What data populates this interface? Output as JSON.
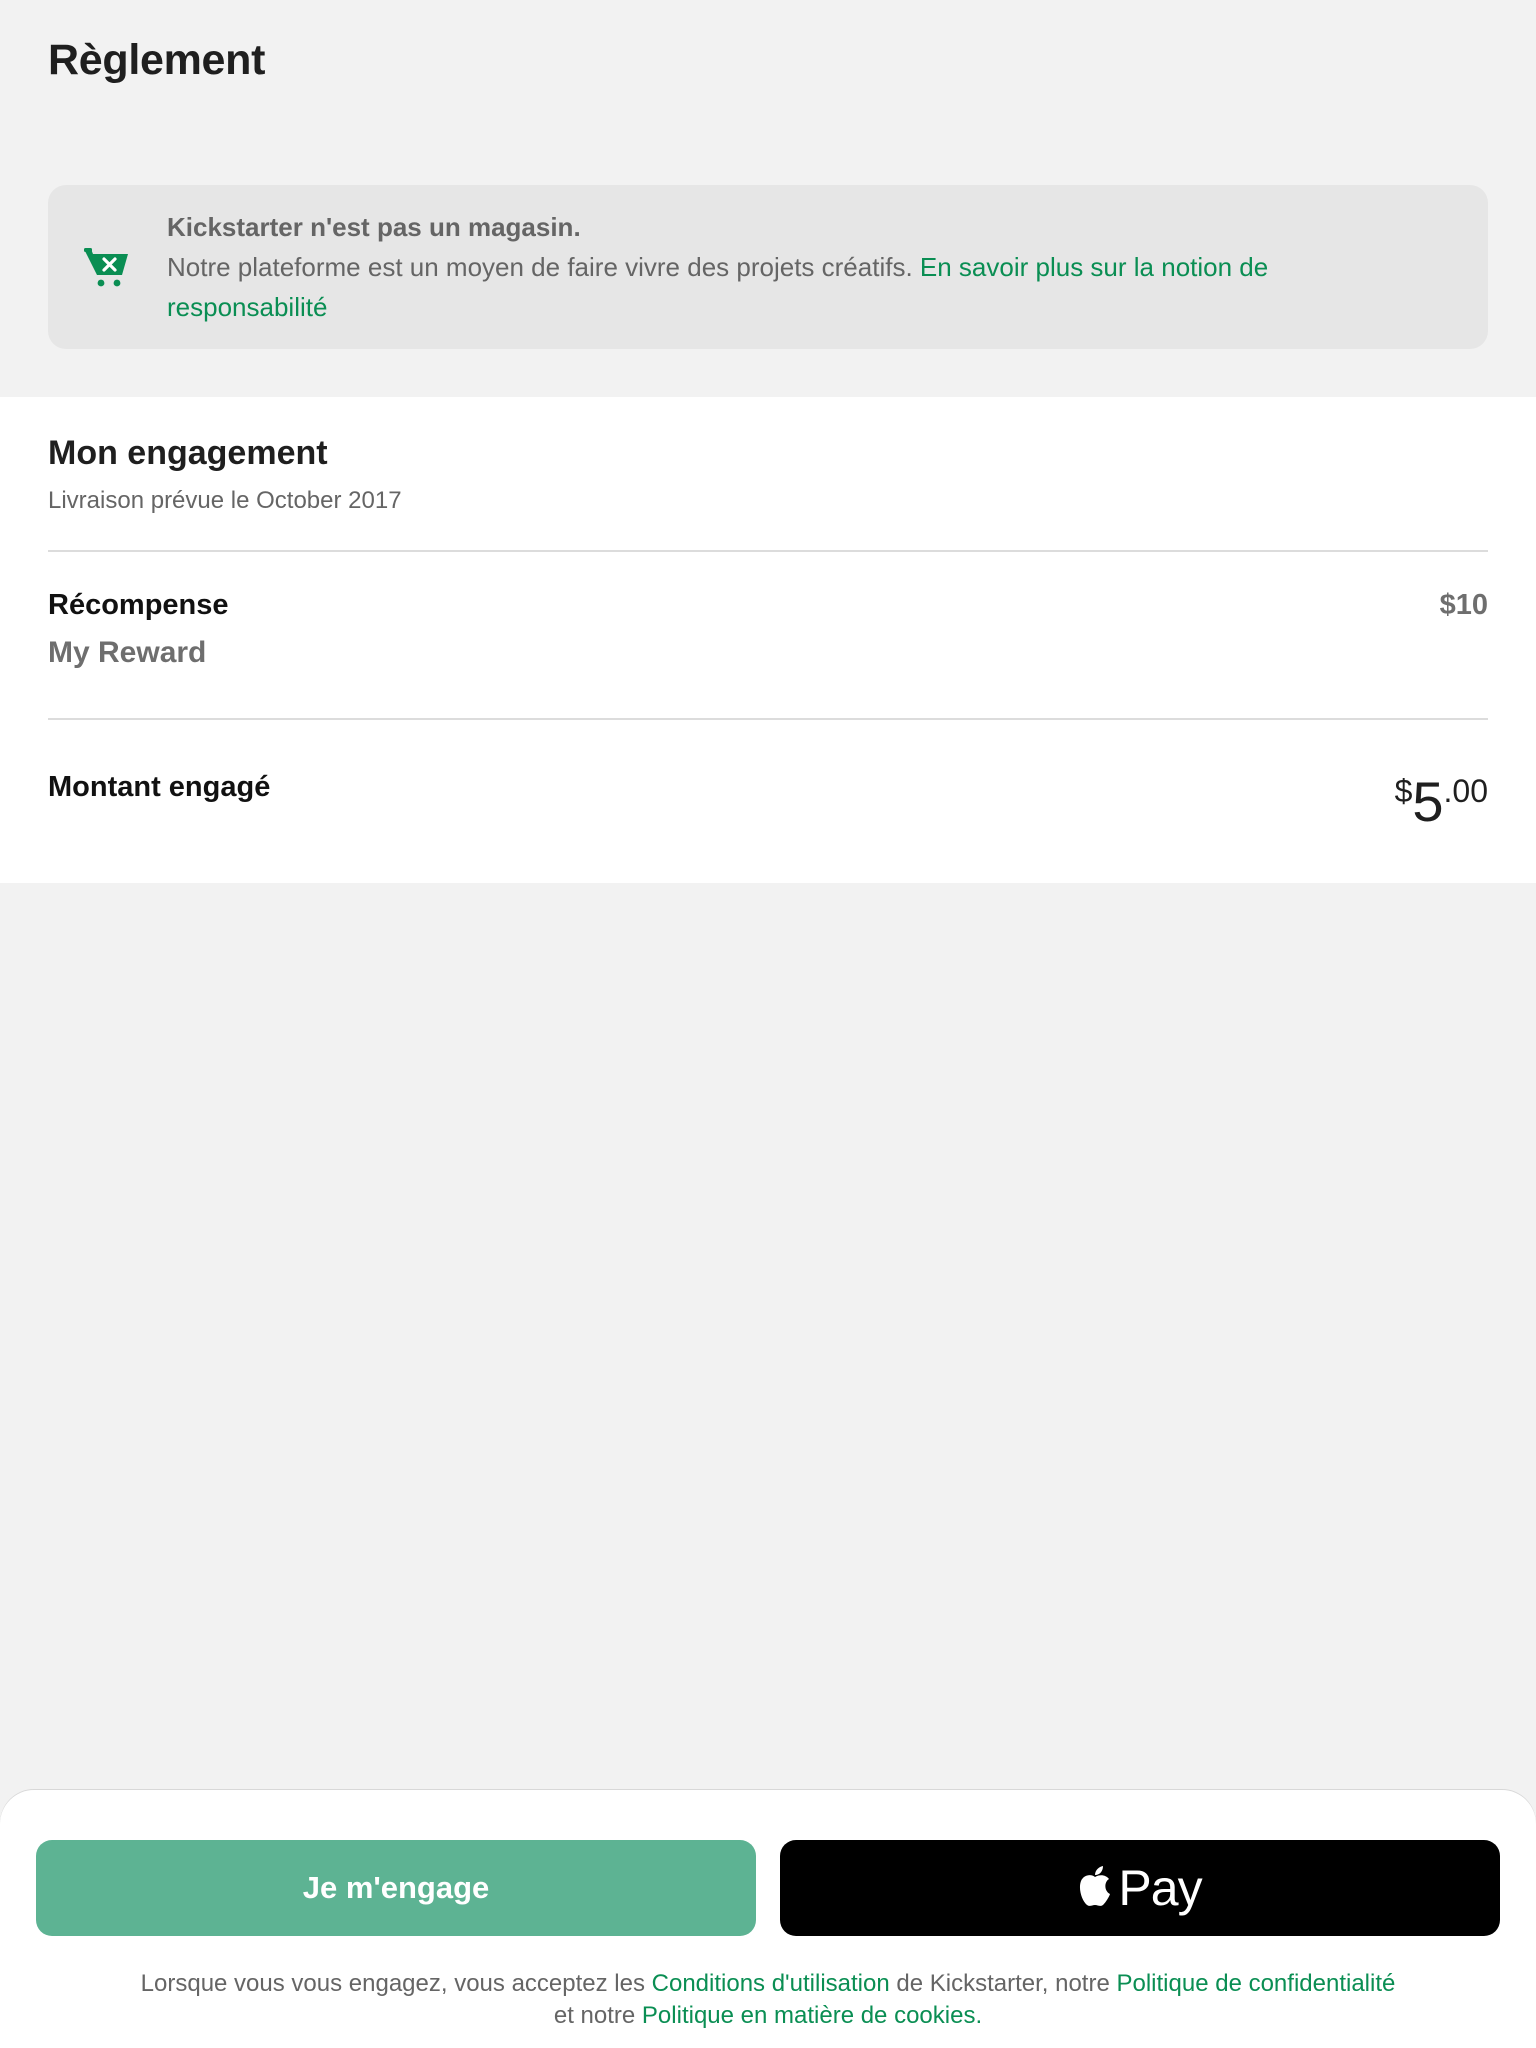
{
  "page": {
    "title": "Règlement"
  },
  "notice": {
    "icon": "cart-x-icon",
    "heading": "Kickstarter n'est pas un magasin.",
    "body": "Notre plateforme est un moyen de faire vivre des projets créatifs. ",
    "link_text": "En savoir plus sur la notion de responsabilité"
  },
  "pledge": {
    "title": "Mon engagement",
    "delivery": "Livraison prévue le October 2017",
    "reward_label": "Récompense",
    "reward_name": "My Reward",
    "reward_price": "$10",
    "amount_label": "Montant engagé",
    "amount_currency": "$",
    "amount_whole": "5",
    "amount_cents": ".00"
  },
  "footer": {
    "pledge_button": "Je m'engage",
    "applepay_icon": "apple-logo-icon",
    "applepay_label": "Pay",
    "legal_prefix": "Lorsque vous vous engagez, vous acceptez les ",
    "terms_link": "Conditions d'utilisation",
    "legal_mid1": " de Kickstarter, notre ",
    "privacy_link": "Politique de confidentialité",
    "legal_mid2": " et notre ",
    "cookie_link": "Politique en matière de cookies",
    "legal_suffix": "."
  },
  "colors": {
    "accent": "#0a8e53",
    "pledge_button": "#5db393",
    "background": "#f2f2f2"
  }
}
